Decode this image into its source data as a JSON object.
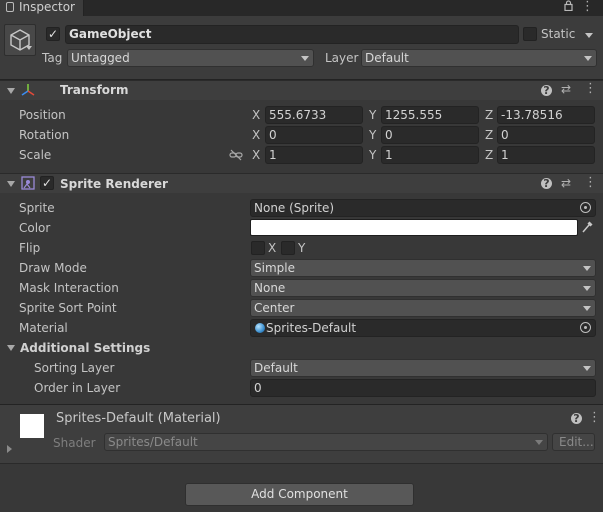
{
  "tab": {
    "title": "Inspector",
    "lock_icon": "lock-icon",
    "menu_icon": "kebab-menu-icon"
  },
  "gameobject": {
    "name": "GameObject",
    "active": true,
    "static_label": "Static",
    "tag_label": "Tag",
    "tag_value": "Untagged",
    "layer_label": "Layer",
    "layer_value": "Default"
  },
  "transform": {
    "title": "Transform",
    "rows": [
      {
        "label": "Position",
        "x": "555.6733",
        "y": "1255.555",
        "z": "-13.78516"
      },
      {
        "label": "Rotation",
        "x": "0",
        "y": "0",
        "z": "0"
      },
      {
        "label": "Scale",
        "x": "1",
        "y": "1",
        "z": "1"
      }
    ],
    "axis": {
      "x": "X",
      "y": "Y",
      "z": "Z"
    }
  },
  "sprite_renderer": {
    "title": "Sprite Renderer",
    "enabled": true,
    "sprite_label": "Sprite",
    "sprite_value": "None (Sprite)",
    "color_label": "Color",
    "color_value": "#ffffff",
    "flip_label": "Flip",
    "flip_x": "X",
    "flip_y": "Y",
    "draw_mode_label": "Draw Mode",
    "draw_mode_value": "Simple",
    "mask_label": "Mask Interaction",
    "mask_value": "None",
    "sort_point_label": "Sprite Sort Point",
    "sort_point_value": "Center",
    "material_label": "Material",
    "material_value": "Sprites-Default",
    "additional_label": "Additional Settings",
    "sorting_layer_label": "Sorting Layer",
    "sorting_layer_value": "Default",
    "order_label": "Order in Layer",
    "order_value": "0"
  },
  "material": {
    "title": "Sprites-Default (Material)",
    "shader_label": "Shader",
    "shader_value": "Sprites/Default",
    "edit_label": "Edit..."
  },
  "add_component_label": "Add Component",
  "colors": {
    "background": "#383838",
    "header": "#3e3e3e",
    "field": "#2a2a2a",
    "dropdown": "#515151",
    "accent": "#3a79bb"
  }
}
